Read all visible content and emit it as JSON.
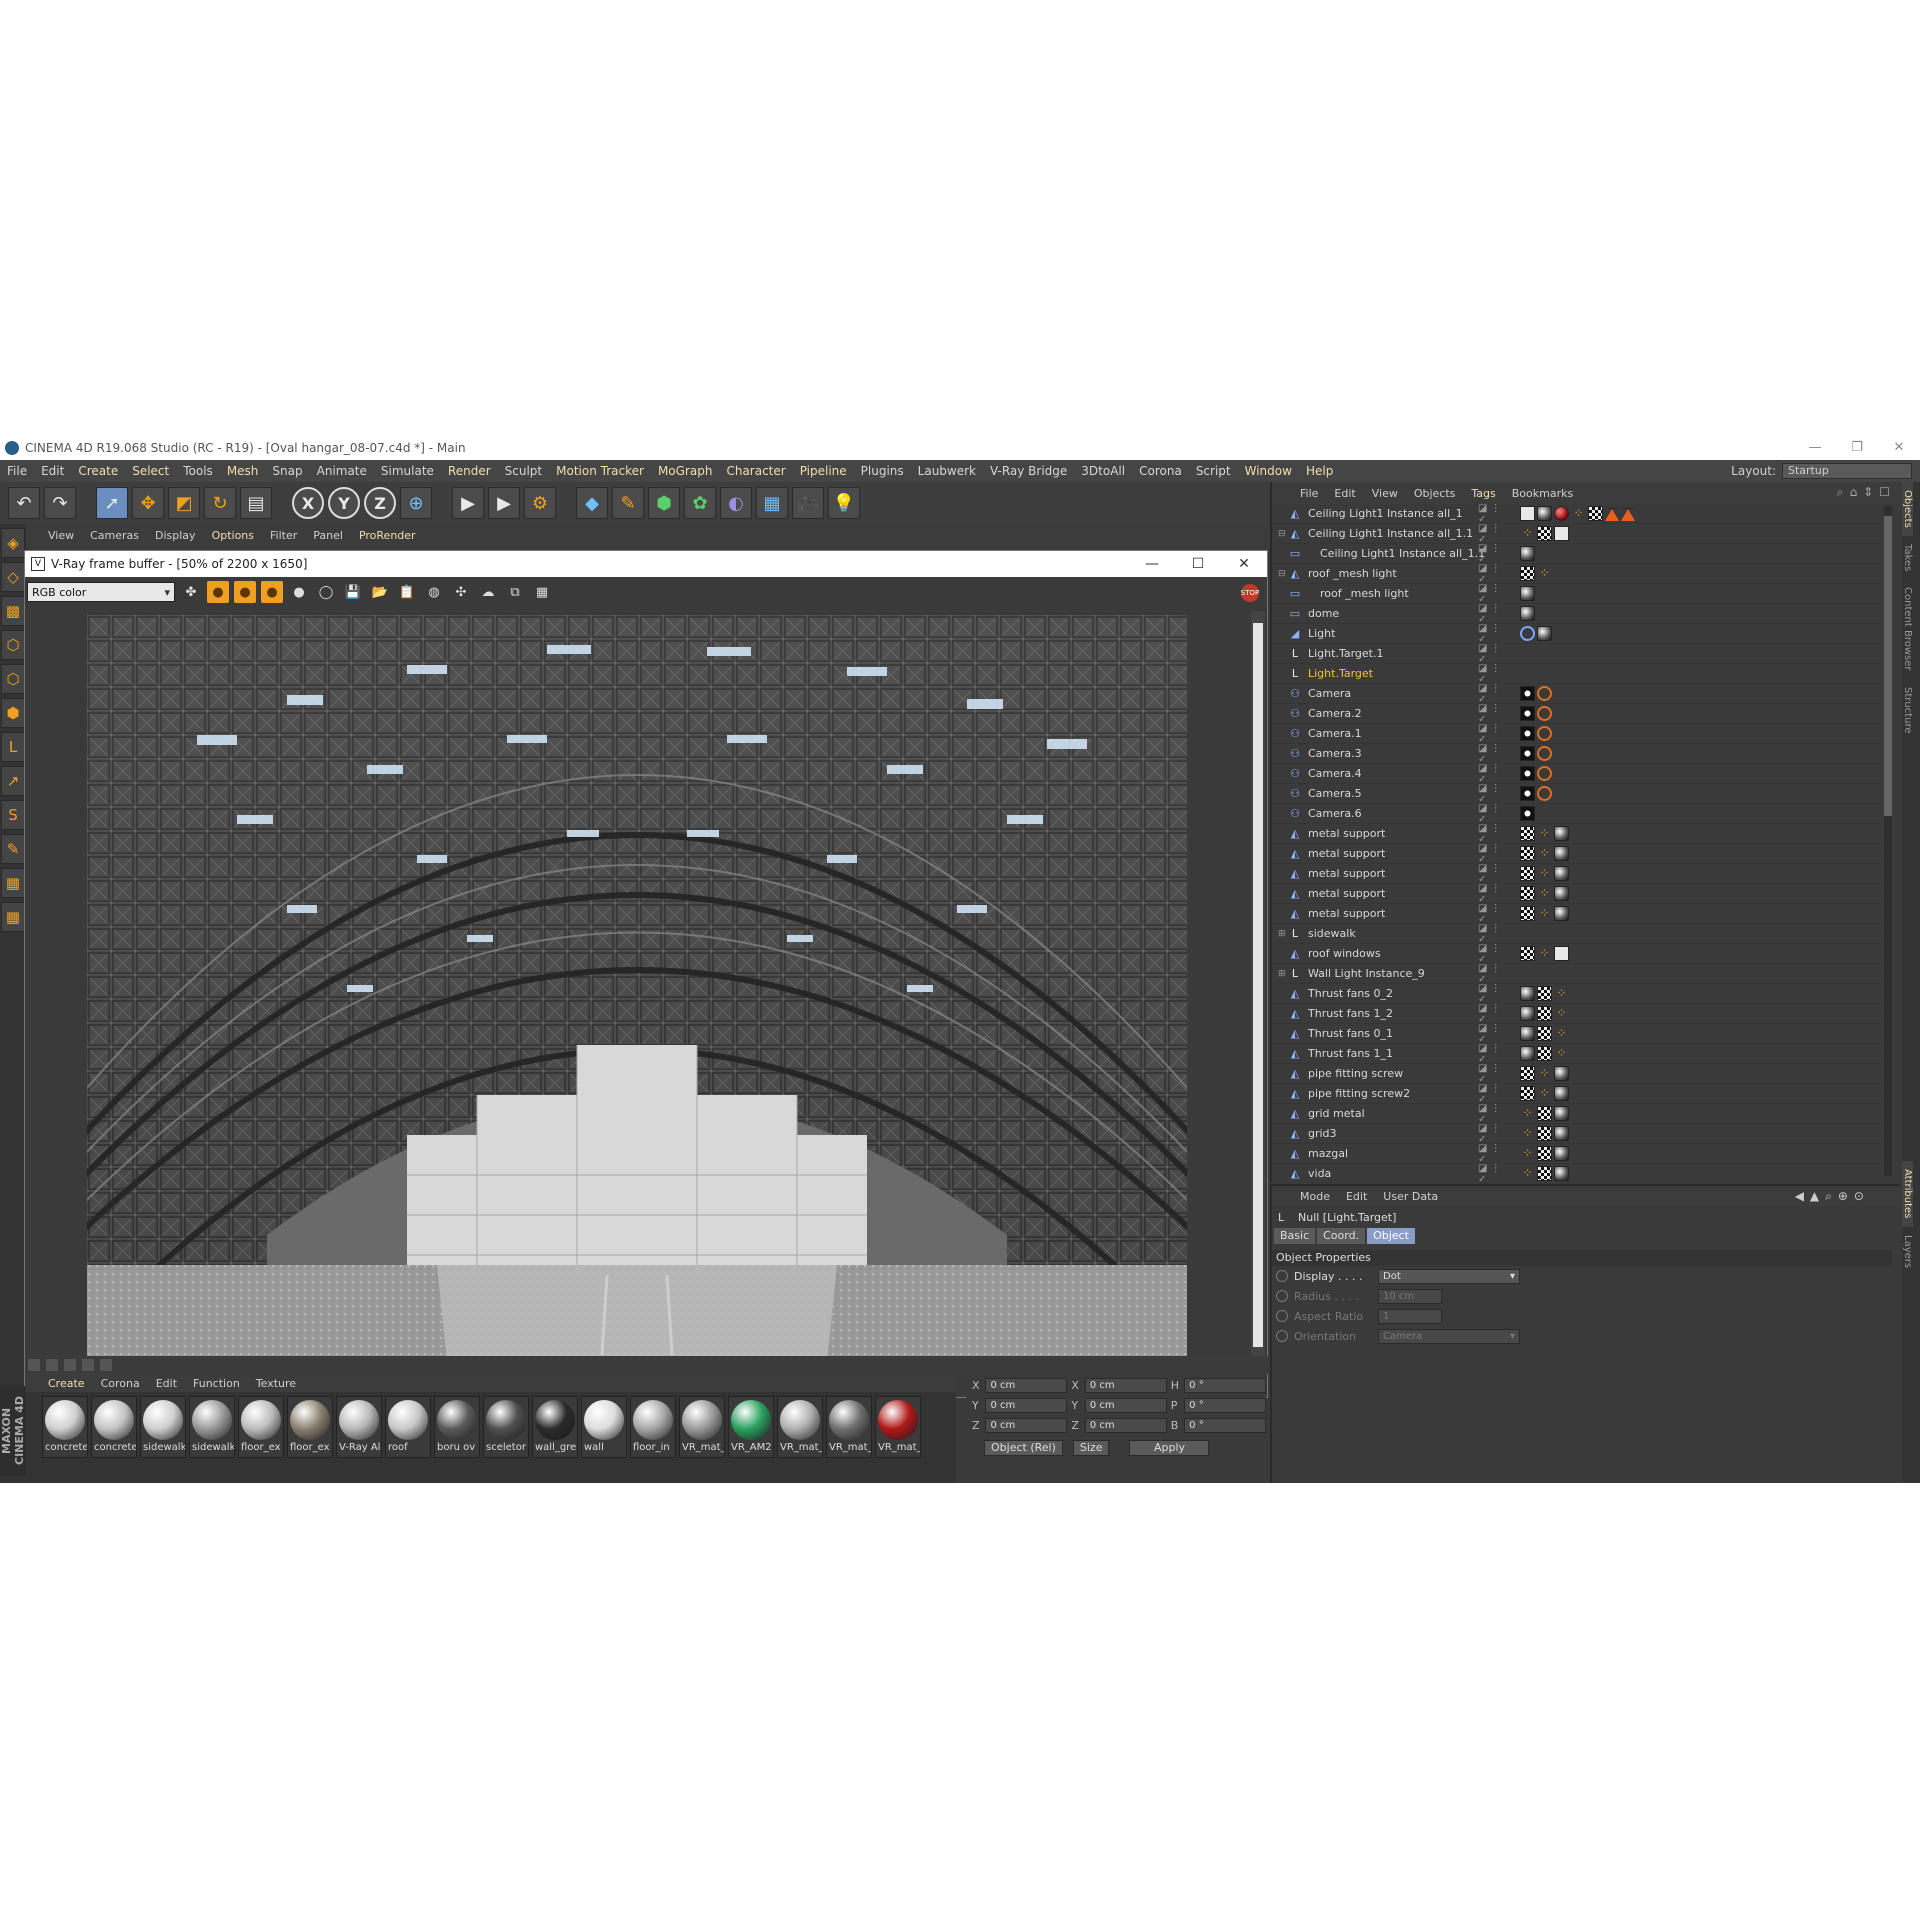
{
  "window": {
    "title": "CINEMA 4D R19.068 Studio (RC - R19) - [Oval hangar_08-07.c4d *] - Main",
    "controls": [
      "—",
      "❐",
      "✕"
    ]
  },
  "menu": [
    "File",
    "Edit",
    "Create",
    "Select",
    "Tools",
    "Mesh",
    "Snap",
    "Animate",
    "Simulate",
    "Render",
    "Sculpt",
    "Motion Tracker",
    "MoGraph",
    "Character",
    "Pipeline",
    "Plugins",
    "Laubwerk",
    "V-Ray Bridge",
    "3DtoAll",
    "Corona",
    "Script",
    "Window",
    "Help"
  ],
  "layout": {
    "label": "Layout:",
    "value": "Startup"
  },
  "viewport_menu": [
    "View",
    "Cameras",
    "Display",
    "Options",
    "Filter",
    "Panel",
    "ProRender"
  ],
  "vfb": {
    "title": "V-Ray frame buffer - [50% of 2200 x 1650]",
    "channel": "RGB color",
    "stop": "STOP"
  },
  "materials": {
    "menu": [
      "Create",
      "Corona",
      "Edit",
      "Function",
      "Texture"
    ],
    "brand": "MAXON CINEMA 4D",
    "items": [
      {
        "label": "concrete",
        "color": "#d0d0d0"
      },
      {
        "label": "concrete",
        "color": "#c4c4c4"
      },
      {
        "label": "sidewalk",
        "color": "#cfcfcf"
      },
      {
        "label": "sidewalk",
        "color": "#9a9a9a"
      },
      {
        "label": "floor_ex",
        "color": "#bdbdbd"
      },
      {
        "label": "floor_ex",
        "color": "#8a8070"
      },
      {
        "label": "V-Ray Al",
        "color": "#b8b8b8"
      },
      {
        "label": "roof",
        "color": "#c8c8c8"
      },
      {
        "label": "boru ov",
        "color": "#5a5a5a"
      },
      {
        "label": "sceletor",
        "color": "#505050"
      },
      {
        "label": "wall_gre",
        "color": "#2a2a2a"
      },
      {
        "label": "wall",
        "color": "#dcdcdc"
      },
      {
        "label": "floor_in",
        "color": "#a8a8a8"
      },
      {
        "label": "VR_mat_",
        "color": "#9a9a9a"
      },
      {
        "label": "VR_AM2",
        "color": "#2aa060"
      },
      {
        "label": "VR_mat_",
        "color": "#b0b0b0"
      },
      {
        "label": "VR_mat_",
        "color": "#707070"
      },
      {
        "label": "VR_mat_",
        "color": "#b01818"
      }
    ]
  },
  "coords": {
    "rows": [
      {
        "a": "X",
        "v1": "0 cm",
        "b": "X",
        "v2": "0 cm",
        "c": "H",
        "v3": "0 °"
      },
      {
        "a": "Y",
        "v1": "0 cm",
        "b": "Y",
        "v2": "0 cm",
        "c": "P",
        "v3": "0 °"
      },
      {
        "a": "Z",
        "v1": "0 cm",
        "b": "Z",
        "v2": "0 cm",
        "c": "B",
        "v3": "0 °"
      }
    ],
    "mode": "Object (Rel)",
    "size": "Size",
    "apply": "Apply"
  },
  "objects": {
    "menu": [
      "File",
      "Edit",
      "View",
      "Objects",
      "Tags",
      "Bookmarks"
    ],
    "rows": [
      {
        "name": "Ceiling Light1 Instance all_1",
        "icon": "◭",
        "exp": "",
        "tags": [
          "wht",
          "sph",
          "red",
          "dot",
          "chk",
          "tri",
          "tri"
        ]
      },
      {
        "name": "Ceiling Light1 Instance all_1.1",
        "icon": "◭",
        "exp": "⊟",
        "tags": [
          "dot",
          "chk",
          "wht"
        ]
      },
      {
        "name": "Ceiling Light1 Instance all_1.1",
        "icon": "▭",
        "exp": "",
        "indent": 1,
        "tags": [
          "sph"
        ]
      },
      {
        "name": "roof _mesh light",
        "icon": "◭",
        "exp": "⊟",
        "tags": [
          "chk",
          "dot"
        ]
      },
      {
        "name": "roof _mesh light",
        "icon": "▭",
        "exp": "",
        "indent": 1,
        "tags": [
          "sph"
        ]
      },
      {
        "name": "dome",
        "icon": "▭",
        "exp": "",
        "tags": [
          "sph"
        ]
      },
      {
        "name": "Light",
        "icon": "◢",
        "exp": "",
        "tags": [
          "ring",
          "sph"
        ]
      },
      {
        "name": "Light.Target.1",
        "icon": "L",
        "exp": "",
        "tags": []
      },
      {
        "name": "Light.Target",
        "icon": "L",
        "exp": "",
        "hl": true,
        "tags": []
      },
      {
        "name": "Camera",
        "icon": "⚇",
        "exp": "",
        "tags": [
          "cam",
          "no"
        ]
      },
      {
        "name": "Camera.2",
        "icon": "⚇",
        "exp": "",
        "tags": [
          "cam",
          "no"
        ]
      },
      {
        "name": "Camera.1",
        "icon": "⚇",
        "exp": "",
        "tags": [
          "cam",
          "no"
        ]
      },
      {
        "name": "Camera.3",
        "icon": "⚇",
        "exp": "",
        "tags": [
          "cam",
          "no"
        ]
      },
      {
        "name": "Camera.4",
        "icon": "⚇",
        "exp": "",
        "tags": [
          "cam",
          "no"
        ]
      },
      {
        "name": "Camera.5",
        "icon": "⚇",
        "exp": "",
        "tags": [
          "cam",
          "no"
        ]
      },
      {
        "name": "Camera.6",
        "icon": "⚇",
        "exp": "",
        "tags": [
          "cam"
        ]
      },
      {
        "name": "metal support",
        "icon": "◭",
        "exp": "",
        "tags": [
          "chk",
          "dot",
          "sph"
        ]
      },
      {
        "name": "metal support",
        "icon": "◭",
        "exp": "",
        "tags": [
          "chk",
          "dot",
          "sph"
        ]
      },
      {
        "name": "metal support",
        "icon": "◭",
        "exp": "",
        "tags": [
          "chk",
          "dot",
          "sph"
        ]
      },
      {
        "name": "metal support",
        "icon": "◭",
        "exp": "",
        "tags": [
          "chk",
          "dot",
          "sph"
        ]
      },
      {
        "name": "metal support",
        "icon": "◭",
        "exp": "",
        "tags": [
          "chk",
          "dot",
          "sph"
        ]
      },
      {
        "name": "sidewalk",
        "icon": "L",
        "exp": "⊞",
        "tags": []
      },
      {
        "name": "roof windows",
        "icon": "◭",
        "exp": "",
        "tags": [
          "chk",
          "dot",
          "wht"
        ]
      },
      {
        "name": "Wall Light Instance_9",
        "icon": "L",
        "exp": "⊞",
        "tags": []
      },
      {
        "name": "Thrust fans 0_2",
        "icon": "◭",
        "exp": "",
        "tags": [
          "sph",
          "chk",
          "dot"
        ]
      },
      {
        "name": "Thrust fans 1_2",
        "icon": "◭",
        "exp": "",
        "tags": [
          "sph",
          "chk",
          "dot"
        ]
      },
      {
        "name": "Thrust fans 0_1",
        "icon": "◭",
        "exp": "",
        "tags": [
          "sph",
          "chk",
          "dot"
        ]
      },
      {
        "name": "Thrust fans 1_1",
        "icon": "◭",
        "exp": "",
        "tags": [
          "sph",
          "chk",
          "dot"
        ]
      },
      {
        "name": "pipe fitting screw",
        "icon": "◭",
        "exp": "",
        "tags": [
          "chk",
          "dot",
          "sph"
        ]
      },
      {
        "name": "pipe fitting screw2",
        "icon": "◭",
        "exp": "",
        "tags": [
          "chk",
          "dot",
          "sph"
        ]
      },
      {
        "name": "grid metal",
        "icon": "◭",
        "exp": "",
        "tags": [
          "dot",
          "chk",
          "sph"
        ]
      },
      {
        "name": "grid3",
        "icon": "◭",
        "exp": "",
        "tags": [
          "dot",
          "chk",
          "sph"
        ]
      },
      {
        "name": "mazgal",
        "icon": "◭",
        "exp": "",
        "tags": [
          "dot",
          "chk",
          "sph"
        ]
      },
      {
        "name": "vida",
        "icon": "◭",
        "exp": "",
        "tags": [
          "dot",
          "chk",
          "sph"
        ]
      }
    ]
  },
  "side_tabs_top": [
    "Objects",
    "Takes",
    "Content Browser",
    "Structure"
  ],
  "side_tabs_bottom": [
    "Attributes",
    "Layers"
  ],
  "attributes": {
    "menu": [
      "Mode",
      "Edit",
      "User Data"
    ],
    "title": "Null [Light.Target]",
    "tabs": [
      "Basic",
      "Coord.",
      "Object"
    ],
    "active_tab": "Object",
    "section": "Object Properties",
    "props": [
      {
        "label": "Display . . . .",
        "value": "Dot",
        "disabled": false,
        "dropdown": true
      },
      {
        "label": "Radius . . . .",
        "value": "10 cm",
        "disabled": true,
        "small": true
      },
      {
        "label": "Aspect Ratio",
        "value": "1",
        "disabled": true,
        "small": true
      },
      {
        "label": "Orientation",
        "value": "Camera",
        "disabled": true,
        "dropdown": true
      }
    ]
  },
  "colors": {
    "accent": "#f0a020",
    "highlight": "#f0c23c",
    "background": "#3a3a3a"
  }
}
